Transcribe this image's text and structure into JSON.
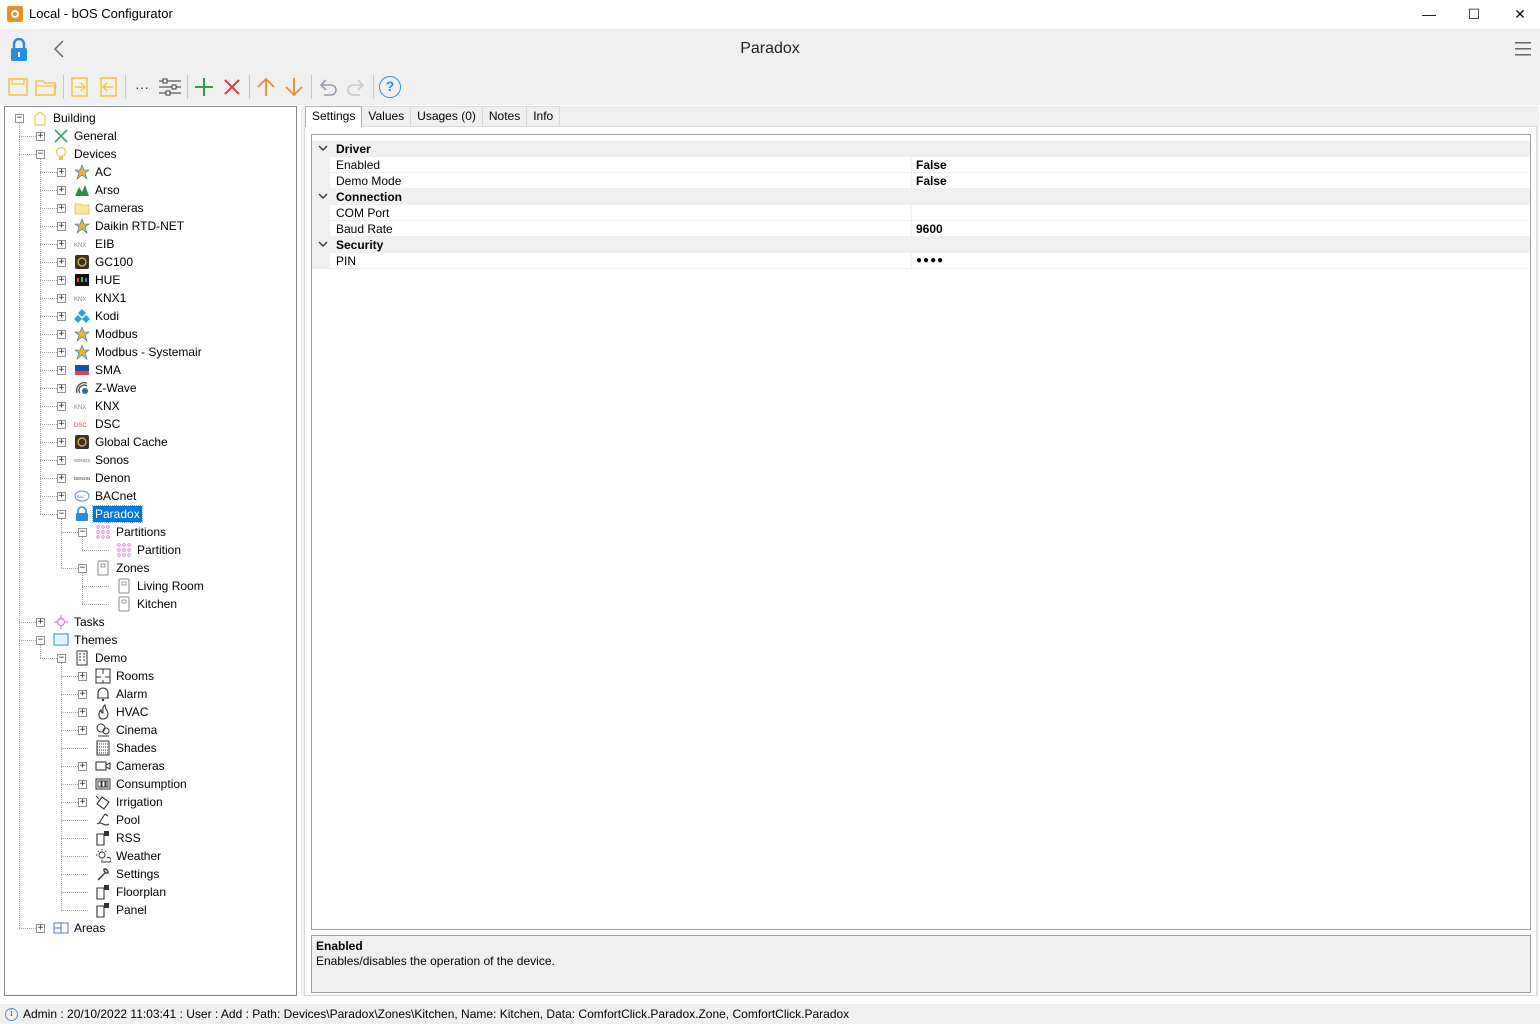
{
  "window": {
    "title": "Local - bOS Configurator",
    "minimize_glyph": "—",
    "maximize_glyph": "☐",
    "close_glyph": "✕"
  },
  "header": {
    "title": "Paradox",
    "icons": [
      "lock-icon",
      "back-icon",
      "hamburger-icon"
    ]
  },
  "toolbar": {
    "icons": [
      "save-icon",
      "open-folder-icon",
      "import-icon",
      "export-icon",
      "more-icon",
      "properties-icon",
      "add-icon",
      "delete-icon",
      "move-up-icon",
      "move-down-icon",
      "undo-icon",
      "redo-icon",
      "help-icon"
    ],
    "more_glyph": "···",
    "help_glyph": "?"
  },
  "tree": {
    "nodes": [
      {
        "label": "Building",
        "icon": "building-icon",
        "expanded": true
      },
      {
        "label": "General",
        "icon": "tools-icon"
      },
      {
        "label": "Devices",
        "icon": "lightbulb-icon",
        "expanded": true
      },
      {
        "label": "AC",
        "icon": "plugin-icon"
      },
      {
        "label": "Arso",
        "icon": "arso-icon"
      },
      {
        "label": "Cameras",
        "icon": "folder-icon"
      },
      {
        "label": "Daikin RTD-NET",
        "icon": "plugin-icon"
      },
      {
        "label": "EIB",
        "icon": "knx-icon"
      },
      {
        "label": "GC100",
        "icon": "globalcache-icon"
      },
      {
        "label": "HUE",
        "icon": "hue-icon"
      },
      {
        "label": "KNX1",
        "icon": "knx-icon"
      },
      {
        "label": "Kodi",
        "icon": "kodi-icon"
      },
      {
        "label": "Modbus",
        "icon": "plugin-icon"
      },
      {
        "label": "Modbus - Systemair",
        "icon": "plugin-icon"
      },
      {
        "label": "SMA",
        "icon": "sma-icon"
      },
      {
        "label": "Z-Wave",
        "icon": "zwave-icon"
      },
      {
        "label": "KNX",
        "icon": "knx-icon"
      },
      {
        "label": "DSC",
        "icon": "dsc-icon"
      },
      {
        "label": "Global Cache",
        "icon": "globalcache-icon"
      },
      {
        "label": "Sonos",
        "icon": "sonos-icon"
      },
      {
        "label": "Denon",
        "icon": "denon-icon"
      },
      {
        "label": "BACnet",
        "icon": "bacnet-icon"
      },
      {
        "label": "Paradox",
        "icon": "lock-icon",
        "selected": true
      },
      {
        "label": "Partitions",
        "icon": "keypad-icon"
      },
      {
        "label": "Partition",
        "icon": "keypad-icon"
      },
      {
        "label": "Zones",
        "icon": "door-sensor-icon"
      },
      {
        "label": "Living Room",
        "icon": "door-sensor-icon"
      },
      {
        "label": "Kitchen",
        "icon": "door-sensor-icon"
      },
      {
        "label": "Tasks",
        "icon": "tasks-icon"
      },
      {
        "label": "Themes",
        "icon": "monitor-icon",
        "expanded": true
      },
      {
        "label": "Demo",
        "icon": "building-tall-icon",
        "expanded": true
      },
      {
        "label": "Rooms",
        "icon": "rooms-icon"
      },
      {
        "label": "Alarm",
        "icon": "bell-icon"
      },
      {
        "label": "HVAC",
        "icon": "flame-icon"
      },
      {
        "label": "Cinema",
        "icon": "cinema-icon"
      },
      {
        "label": "Shades",
        "icon": "shades-icon"
      },
      {
        "label": "Cameras",
        "icon": "camera-icon"
      },
      {
        "label": "Consumption",
        "icon": "meter-icon"
      },
      {
        "label": "Irrigation",
        "icon": "irrigation-icon"
      },
      {
        "label": "Pool",
        "icon": "pool-icon"
      },
      {
        "label": "RSS",
        "icon": "page-icon"
      },
      {
        "label": "Weather",
        "icon": "weather-icon"
      },
      {
        "label": "Settings",
        "icon": "wrench-icon"
      },
      {
        "label": "Floorplan",
        "icon": "page-icon"
      },
      {
        "label": "Panel",
        "icon": "page-icon"
      },
      {
        "label": "Areas",
        "icon": "areas-icon"
      }
    ]
  },
  "tabs": [
    {
      "label": "Settings",
      "active": true
    },
    {
      "label": "Values"
    },
    {
      "label": "Usages (0)"
    },
    {
      "label": "Notes"
    },
    {
      "label": "Info"
    }
  ],
  "properties": {
    "categories": [
      {
        "name": "Driver",
        "rows": [
          {
            "name": "Enabled",
            "value": "False"
          },
          {
            "name": "Demo Mode",
            "value": "False"
          }
        ]
      },
      {
        "name": "Connection",
        "rows": [
          {
            "name": "COM Port",
            "value": ""
          },
          {
            "name": "Baud Rate",
            "value": "9600"
          }
        ]
      },
      {
        "name": "Security",
        "rows": [
          {
            "name": "PIN",
            "value": "●●●●"
          }
        ]
      }
    ]
  },
  "help": {
    "title": "Enabled",
    "description": "Enables/disables the operation of the device."
  },
  "status": {
    "info_glyph": "i",
    "text": "Admin : 20/10/2022 11:03:41 : User : Add : Path: Devices\\Paradox\\Zones\\Kitchen, Name: Kitchen, Data: ComfortClick.Paradox.Zone, ComfortClick.Paradox"
  },
  "colors": {
    "accent_selection": "#0078d7",
    "add_green": "#2ea043",
    "delete_red": "#e04040",
    "arrow_orange": "#f08a24",
    "toolbar_yellow": "#f5c242",
    "lock_blue": "#2a8be0"
  }
}
